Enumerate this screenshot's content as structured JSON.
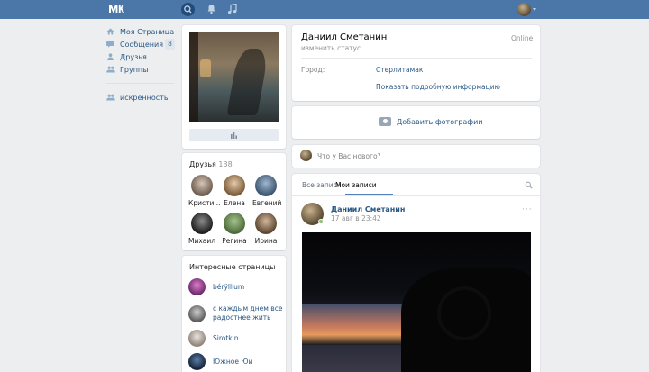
{
  "nav": {
    "items": [
      {
        "label": "Моя Страница",
        "icon": "home-icon"
      },
      {
        "label": "Сообщения",
        "icon": "messages-icon",
        "badge": "8"
      },
      {
        "label": "Друзья",
        "icon": "friends-icon"
      },
      {
        "label": "Группы",
        "icon": "groups-icon"
      }
    ],
    "extra": {
      "label": "йскренность",
      "icon": "groups-icon"
    }
  },
  "friends": {
    "title": "Друзья",
    "count": "138",
    "items": [
      {
        "name": "Кристи..."
      },
      {
        "name": "Елена"
      },
      {
        "name": "Евгений"
      },
      {
        "name": "Михаил"
      },
      {
        "name": "Регина"
      },
      {
        "name": "Ирина"
      }
    ]
  },
  "interesting": {
    "title": "Интересные страницы",
    "items": [
      {
        "name": "bérÿllium"
      },
      {
        "name": "с каждым днем все радостнее жить"
      },
      {
        "name": "Sirotkin"
      },
      {
        "name": "Южное Юи"
      }
    ]
  },
  "profile": {
    "name": "Даниил Сметанин",
    "status": "изменить статус",
    "online": "Online",
    "city_label": "Город:",
    "city_value": "Стерлитамак",
    "more_info": "Показать подробную информацию"
  },
  "add_photo": "Добавить фотографии",
  "new_post_placeholder": "Что у Вас нового?",
  "tabs": {
    "all": "Все записи",
    "mine": "Мои записи"
  },
  "post": {
    "author": "Даниил Сметанин",
    "date": "17 авг в 23:42",
    "more": "···"
  },
  "colors": {
    "header": "#4a76a8",
    "link": "#2a5885",
    "accent": "#5181b8"
  }
}
